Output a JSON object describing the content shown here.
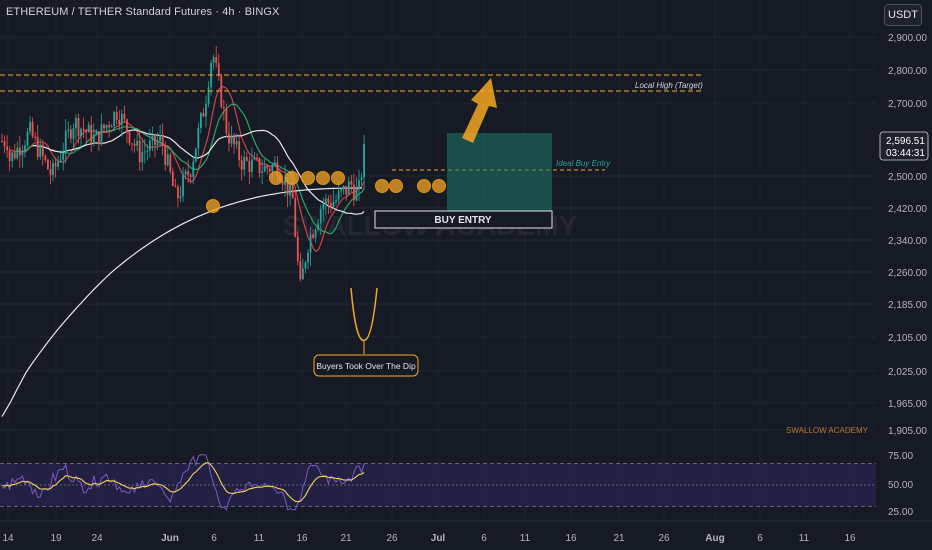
{
  "header": {
    "symbol_title": "ETHEREUM / TETHER Standard Futures · 4h · BINGX",
    "currency_button": "USDT"
  },
  "chart_data": [
    {
      "type": "candlestick",
      "title": "ETHEREUM / TETHER Standard Futures · 4h · BINGX",
      "y_ticks": [
        2900,
        2800,
        2700,
        2500,
        2420,
        2340,
        2260,
        2185,
        2105,
        2025,
        1965,
        1905
      ],
      "y_tick_labels": [
        "2,900.00",
        "2,800.00",
        "2,700.00",
        "2,500.00",
        "2,420.00",
        "2,340.00",
        "2,260.00",
        "2,185.00",
        "2,105.00",
        "2,025.00",
        "1,965.00",
        "1,905.00"
      ],
      "x_tick_labels": [
        "14",
        "19",
        "24",
        "Jun",
        "6",
        "11",
        "16",
        "21",
        "26",
        "Jul",
        "6",
        "11",
        "16",
        "21",
        "26",
        "Aug",
        "6",
        "11",
        "16"
      ],
      "current_price": "2,596.51",
      "countdown": "03:44:31",
      "moving_averages": [
        "red",
        "green",
        "white",
        "white"
      ],
      "price_series_approx": [
        {
          "x": "May 14",
          "y": 2540
        },
        {
          "x": "May 17",
          "y": 2620
        },
        {
          "x": "May 20",
          "y": 2500
        },
        {
          "x": "May 23",
          "y": 2650
        },
        {
          "x": "May 26",
          "y": 2600
        },
        {
          "x": "May 29",
          "y": 2680
        },
        {
          "x": "Jun 1",
          "y": 2560
        },
        {
          "x": "Jun 4",
          "y": 2600
        },
        {
          "x": "Jun 6",
          "y": 2440
        },
        {
          "x": "Jun 8",
          "y": 2520
        },
        {
          "x": "Jun 10",
          "y": 2700
        },
        {
          "x": "Jun 11",
          "y": 2860
        },
        {
          "x": "Jun 13",
          "y": 2620
        },
        {
          "x": "Jun 15",
          "y": 2540
        },
        {
          "x": "Jun 18",
          "y": 2520
        },
        {
          "x": "Jun 20",
          "y": 2530
        },
        {
          "x": "Jun 22",
          "y": 2440
        },
        {
          "x": "Jun 23",
          "y": 2210
        },
        {
          "x": "Jun 24",
          "y": 2330
        },
        {
          "x": "Jun 26",
          "y": 2430
        },
        {
          "x": "Jun 28",
          "y": 2440
        },
        {
          "x": "Jun 30",
          "y": 2480
        },
        {
          "x": "Jul 1",
          "y": 2450
        },
        {
          "x": "Jul 2",
          "y": 2596
        }
      ],
      "annotations": {
        "target_label": "Local High (Target)",
        "ideal_entry_label": "Ideal Buy Entry",
        "buy_entry_label": "BUY ENTRY",
        "dip_label": "Buyers Took Over The Dip",
        "watermark_center": "SWALLOW ACADEMY",
        "watermark_corner": "SWALLOW ACADEMY"
      },
      "colors": {
        "up": "#26a69a",
        "down": "#ef5350",
        "annotation": "#f5a623",
        "box": "#1f7a6b"
      }
    },
    {
      "type": "line",
      "indicator": "RSI",
      "y_ticks": [
        75,
        50,
        25
      ],
      "y_tick_labels": [
        "75.00",
        "50.00",
        "25.00"
      ],
      "levels": [
        70,
        50,
        30
      ],
      "colors": {
        "rsi": "#7e57c2",
        "signal": "#f0d258",
        "band": "#2a2550"
      }
    }
  ]
}
